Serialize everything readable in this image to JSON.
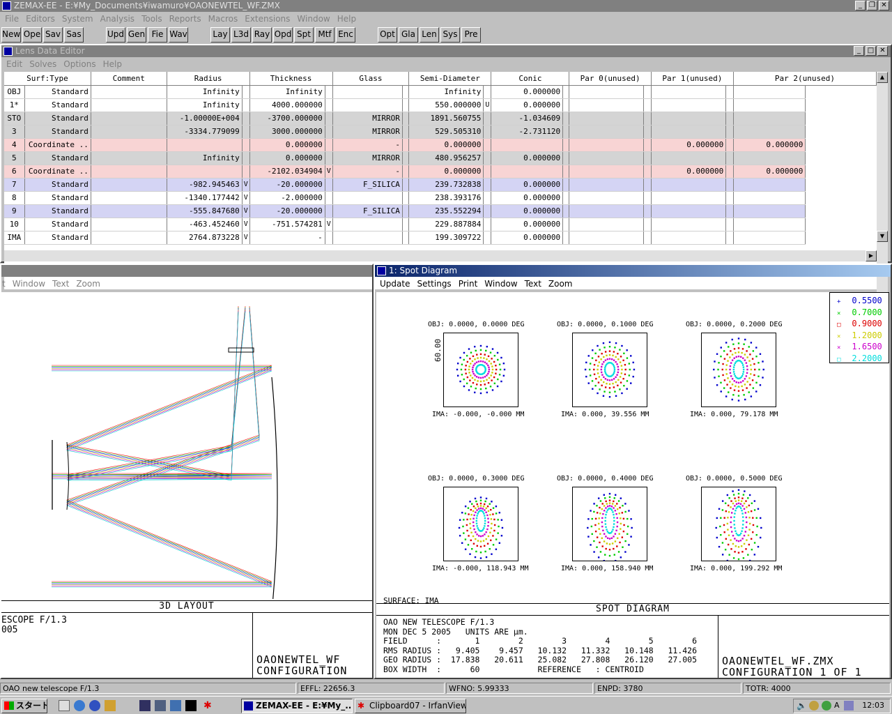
{
  "app": {
    "title": "ZEMAX-EE - E:¥My_Documents¥iwamuro¥OAONEWTEL_WF.ZMX",
    "menu": [
      "File",
      "Editors",
      "System",
      "Analysis",
      "Tools",
      "Reports",
      "Macros",
      "Extensions",
      "Window",
      "Help"
    ],
    "toolbar": [
      "New",
      "Ope",
      "Sav",
      "Sas",
      "Upd",
      "Gen",
      "Fie",
      "Wav",
      "Lay",
      "L3d",
      "Ray",
      "Opd",
      "Spt",
      "Mtf",
      "Enc",
      "Opt",
      "Gla",
      "Len",
      "Sys",
      "Pre"
    ]
  },
  "lde": {
    "title": "Lens Data Editor",
    "menu": [
      "Edit",
      "Solves",
      "Options",
      "Help"
    ],
    "columns": [
      "Surf:Type",
      "Comment",
      "Radius",
      "Thickness",
      "Glass",
      "Semi-Diameter",
      "Conic",
      "Par 0(unused)",
      "Par 1(unused)",
      "Par 2(unused)"
    ],
    "rows": [
      {
        "surf": "OBJ",
        "type": "Standard",
        "comment": "",
        "radius": "Infinity",
        "rs": "",
        "thick": "Infinity",
        "ts": "",
        "glass": "",
        "semi": "Infinity",
        "ss": "",
        "conic": "0.000000",
        "p0": "",
        "p1": "",
        "p2": "",
        "style": ""
      },
      {
        "surf": "1*",
        "type": "Standard",
        "comment": "",
        "radius": "Infinity",
        "rs": "",
        "thick": "4000.000000",
        "ts": "",
        "glass": "",
        "semi": "550.000000",
        "ss": "U",
        "conic": "0.000000",
        "p0": "",
        "p1": "",
        "p2": "",
        "style": ""
      },
      {
        "surf": "STO",
        "type": "Standard",
        "comment": "",
        "radius": "-1.00000E+004",
        "rs": "",
        "thick": "-3700.000000",
        "ts": "",
        "glass": "MIRROR",
        "semi": "1891.560755",
        "ss": "",
        "conic": "-1.034609",
        "p0": "",
        "p1": "",
        "p2": "",
        "style": "gray"
      },
      {
        "surf": "3",
        "type": "Standard",
        "comment": "",
        "radius": "-3334.779099",
        "rs": "",
        "thick": "3000.000000",
        "ts": "",
        "glass": "MIRROR",
        "semi": "529.505310",
        "ss": "",
        "conic": "-2.731120",
        "p0": "",
        "p1": "",
        "p2": "",
        "style": "gray"
      },
      {
        "surf": "4",
        "type": "Coordinate ..",
        "comment": "",
        "radius": "",
        "rs": "",
        "thick": "0.000000",
        "ts": "",
        "glass": "-",
        "semi": "0.000000",
        "ss": "",
        "conic": "",
        "p0": "",
        "p1": "0.000000",
        "p2": "0.000000",
        "style": "pink"
      },
      {
        "surf": "5",
        "type": "Standard",
        "comment": "",
        "radius": "Infinity",
        "rs": "",
        "thick": "0.000000",
        "ts": "",
        "glass": "MIRROR",
        "semi": "480.956257",
        "ss": "",
        "conic": "0.000000",
        "p0": "",
        "p1": "",
        "p2": "",
        "style": "gray"
      },
      {
        "surf": "6",
        "type": "Coordinate ..",
        "comment": "",
        "radius": "",
        "rs": "",
        "thick": "-2102.034904",
        "ts": "V",
        "glass": "-",
        "semi": "0.000000",
        "ss": "",
        "conic": "",
        "p0": "",
        "p1": "0.000000",
        "p2": "0.000000",
        "style": "pink"
      },
      {
        "surf": "7",
        "type": "Standard",
        "comment": "",
        "radius": "-982.945463",
        "rs": "V",
        "thick": "-20.000000",
        "ts": "",
        "glass": "F_SILICA",
        "semi": "239.732838",
        "ss": "",
        "conic": "0.000000",
        "p0": "",
        "p1": "",
        "p2": "",
        "style": "blue"
      },
      {
        "surf": "8",
        "type": "Standard",
        "comment": "",
        "radius": "-1340.177442",
        "rs": "V",
        "thick": "-2.000000",
        "ts": "",
        "glass": "",
        "semi": "238.393176",
        "ss": "",
        "conic": "0.000000",
        "p0": "",
        "p1": "",
        "p2": "",
        "style": ""
      },
      {
        "surf": "9",
        "type": "Standard",
        "comment": "",
        "radius": "-555.847680",
        "rs": "V",
        "thick": "-20.000000",
        "ts": "",
        "glass": "F_SILICA",
        "semi": "235.552294",
        "ss": "",
        "conic": "0.000000",
        "p0": "",
        "p1": "",
        "p2": "",
        "style": "blue"
      },
      {
        "surf": "10",
        "type": "Standard",
        "comment": "",
        "radius": "-463.452460",
        "rs": "V",
        "thick": "-751.574281",
        "ts": "V",
        "glass": "",
        "semi": "229.887884",
        "ss": "",
        "conic": "0.000000",
        "p0": "",
        "p1": "",
        "p2": "",
        "style": ""
      },
      {
        "surf": "IMA",
        "type": "Standard",
        "comment": "",
        "radius": "2764.873228",
        "rs": "V",
        "thick": "-",
        "ts": "",
        "glass": "",
        "semi": "199.309722",
        "ss": "",
        "conic": "0.000000",
        "p0": "",
        "p1": "",
        "p2": "",
        "style": ""
      }
    ]
  },
  "layout": {
    "menu": [
      "t",
      "Window",
      "Text",
      "Zoom"
    ],
    "footer_title": "3D LAYOUT",
    "info_line1": "ESCOPE F/1.3",
    "info_line2": "005",
    "file_line1": "OAONEWTEL_WF",
    "file_line2": "CONFIGURATION"
  },
  "spot": {
    "title": "1: Spot Diagram",
    "menu": [
      "Update",
      "Settings",
      "Print",
      "Window",
      "Text",
      "Zoom"
    ],
    "legend": [
      {
        "wl": "0.5500",
        "color": "#0000cc",
        "sym": "+"
      },
      {
        "wl": "0.7000",
        "color": "#00cc00",
        "sym": "×"
      },
      {
        "wl": "0.9000",
        "color": "#dd0000",
        "sym": "□"
      },
      {
        "wl": "1.2000",
        "color": "#cccc00",
        "sym": "×"
      },
      {
        "wl": "1.6500",
        "color": "#cc00cc",
        "sym": "×"
      },
      {
        "wl": "2.2000",
        "color": "#00dddd",
        "sym": "□"
      }
    ],
    "fields": [
      {
        "obj": "OBJ: 0.0000, 0.0000 DEG",
        "ima": "IMA: -0.000, -0.000 MM"
      },
      {
        "obj": "OBJ: 0.0000, 0.1000 DEG",
        "ima": "IMA: 0.000, 39.556 MM"
      },
      {
        "obj": "OBJ: 0.0000, 0.2000 DEG",
        "ima": "IMA: 0.000, 79.178 MM"
      },
      {
        "obj": "OBJ: 0.0000, 0.3000 DEG",
        "ima": "IMA: -0.000, 118.943 MM"
      },
      {
        "obj": "OBJ: 0.0000, 0.4000 DEG",
        "ima": "IMA: 0.000, 158.940 MM"
      },
      {
        "obj": "OBJ: 0.0000, 0.5000 DEG",
        "ima": "IMA: 0.000, 199.292 MM"
      }
    ],
    "scale_label": "60.00",
    "surface": "SURFACE: IMA",
    "footer_title": "SPOT DIAGRAM",
    "info": [
      "OAO NEW TELESCOPE F/1.3",
      "MON DEC 5 2005   UNITS ARE µm.",
      "FIELD      :       1        2        3        4        5        6",
      "RMS RADIUS :   9.405    9.457   10.132   11.332   10.148   11.426",
      "GEO RADIUS :  17.838   20.611   25.082   27.808   26.120   27.005",
      "BOX WIDTH  :      60            REFERENCE   : CENTROID"
    ],
    "file_line1": "OAONEWTEL_WF.ZMX",
    "file_line2": "CONFIGURATION 1 OF 1"
  },
  "status": [
    "OAO new telescope F/1.3",
    "EFFL: 22656.3",
    "WFNO: 5.99333",
    "ENPD: 3780",
    "TOTR: 4000"
  ],
  "taskbar": {
    "start": "スタート",
    "tasks": [
      "ZEMAX-EE - E:¥My_...",
      "Clipboard07 - IrfanView"
    ],
    "clock": "12:03"
  }
}
